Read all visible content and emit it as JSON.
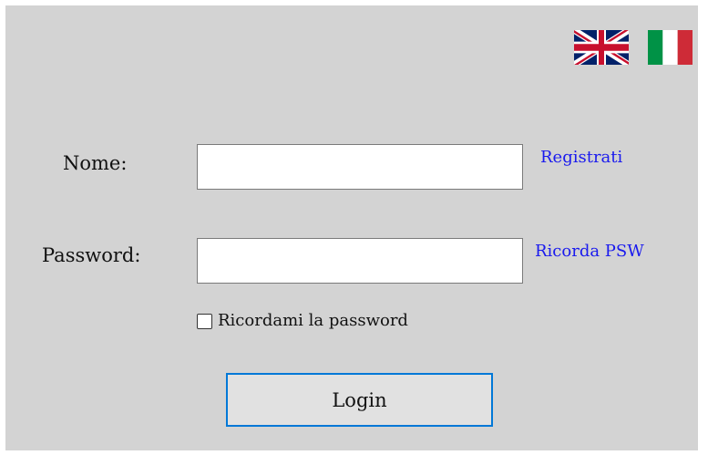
{
  "languages": [
    {
      "name": "English",
      "icon": "uk-flag-icon"
    },
    {
      "name": "Italiano",
      "icon": "italy-flag-icon"
    }
  ],
  "form": {
    "name_label": "Nome:",
    "name_value": "",
    "password_label": "Password:",
    "password_value": "",
    "register_link": "Registrati",
    "recover_link": "Ricorda PSW",
    "remember_label": "Ricordami la password",
    "remember_checked": false,
    "login_label": "Login"
  },
  "colors": {
    "background": "#d3d3d3",
    "link": "#1a1aee",
    "button_focus_border": "#0078d7",
    "button_bg": "#e1e1e1"
  }
}
